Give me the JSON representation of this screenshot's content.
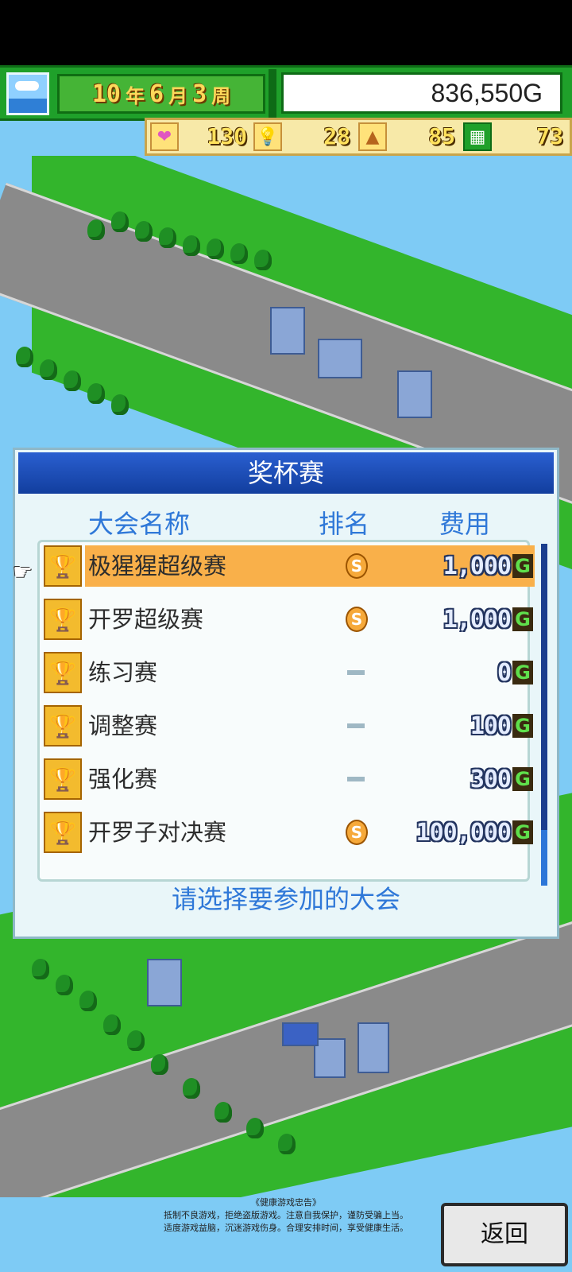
{
  "hud": {
    "year_num": "10",
    "year_unit": "年",
    "month_num": "6",
    "month_unit": "月",
    "week_num": "3",
    "week_unit": "周",
    "money": "836,550G",
    "stats": [
      {
        "icon": "heart-icon",
        "value": "130",
        "color": "#e056c0"
      },
      {
        "icon": "lightbulb-icon",
        "value": "28",
        "color": "#ffe27a"
      },
      {
        "icon": "bread-icon",
        "value": "85",
        "color": "#ffe27a"
      },
      {
        "icon": "field-icon",
        "value": "73",
        "color": "#1fa02a"
      }
    ]
  },
  "dialog": {
    "title": "奖杯赛",
    "col_name": "大会名称",
    "col_rank": "排名",
    "col_fee": "费用",
    "rows": [
      {
        "name": "极猩猩超级赛",
        "rank": "S",
        "fee": "1,000",
        "currency": "G",
        "selected": true
      },
      {
        "name": "开罗超级赛",
        "rank": "S",
        "fee": "1,000",
        "currency": "G"
      },
      {
        "name": "练习赛",
        "rank": "—",
        "fee": "0",
        "currency": "G"
      },
      {
        "name": "调整赛",
        "rank": "—",
        "fee": "100",
        "currency": "G"
      },
      {
        "name": "强化赛",
        "rank": "—",
        "fee": "300",
        "currency": "G"
      },
      {
        "name": "开罗子对决赛",
        "rank": "S",
        "fee": "100,000",
        "currency": "G"
      }
    ],
    "prompt": "请选择要参加的大会"
  },
  "notice": {
    "line1": "《健康游戏忠告》",
    "line2": "抵制不良游戏，拒绝盗版游戏。注意自我保护，谨防受骗上当。",
    "line3": "适度游戏益脑，沉迷游戏伤身。合理安排时间，享受健康生活。"
  },
  "back_button": "返回",
  "colors": {
    "hud_green": "#1fa02a",
    "dialog_title_blue": "#2a5fd0",
    "highlight_orange": "#f9b04a",
    "header_text_blue": "#2f78d8"
  }
}
